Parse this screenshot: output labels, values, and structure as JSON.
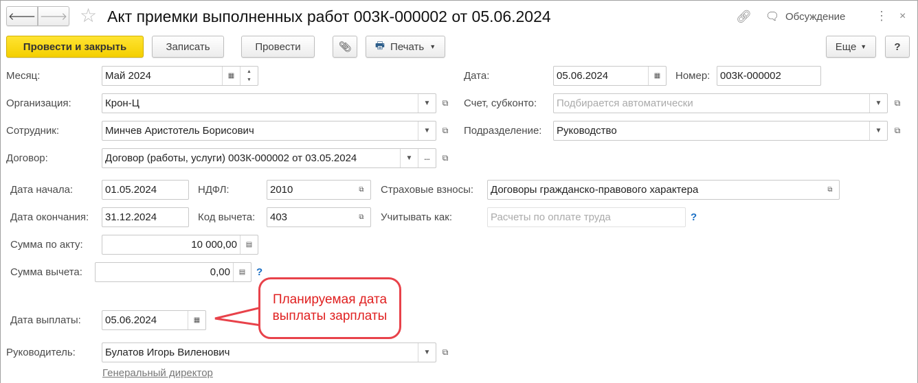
{
  "window": {
    "title": "Акт приемки выполненных работ 003К-000002 от 05.06.2024",
    "discussion": "Обсуждение"
  },
  "toolbar": {
    "post_close": "Провести и закрыть",
    "save": "Записать",
    "post": "Провести",
    "print": "Печать",
    "more": "Еще",
    "help": "?"
  },
  "form": {
    "month": {
      "label": "Месяц:",
      "value": "Май 2024"
    },
    "date": {
      "label": "Дата:",
      "value": "05.06.2024"
    },
    "number": {
      "label": "Номер:",
      "value": "003К-000002"
    },
    "org": {
      "label": "Организация:",
      "value": "Крон-Ц"
    },
    "account": {
      "label": "Счет, субконто:",
      "placeholder": "Подбирается автоматически"
    },
    "employee": {
      "label": "Сотрудник:",
      "value": "Минчев Аристотель Борисович"
    },
    "dept": {
      "label": "Подразделение:",
      "value": "Руководство"
    },
    "contract": {
      "label": "Договор:",
      "value": "Договор (работы, услуги) 003К-000002 от 03.05.2024"
    },
    "start": {
      "label": "Дата начала:",
      "value": "01.05.2024"
    },
    "ndfl": {
      "label": "НДФЛ:",
      "value": "2010"
    },
    "insurance": {
      "label": "Страховые взносы:",
      "value": "Договоры гражданско-правового характера"
    },
    "end": {
      "label": "Дата окончания:",
      "value": "31.12.2024"
    },
    "deduction_code": {
      "label": "Код вычета:",
      "value": "403"
    },
    "account_as": {
      "label": "Учитывать как:",
      "placeholder": "Расчеты по оплате труда"
    },
    "act_sum": {
      "label": "Сумма по акту:",
      "value": "10 000,00"
    },
    "deduction_sum": {
      "label": "Сумма вычета:",
      "value": "0,00"
    },
    "pay_date": {
      "label": "Дата выплаты:",
      "value": "05.06.2024"
    },
    "head": {
      "label": "Руководитель:",
      "value": "Булатов Игорь Виленович",
      "position": "Генеральный директор"
    },
    "question": "?"
  },
  "callout": {
    "text": "Планируемая дата выплаты зарплаты"
  }
}
